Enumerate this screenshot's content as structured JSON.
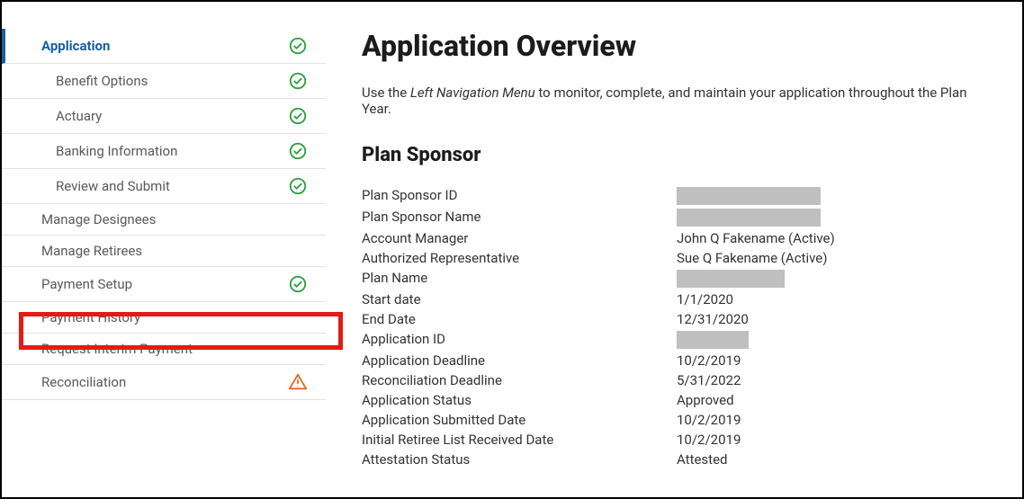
{
  "sidebar": {
    "items": [
      {
        "label": "Application",
        "status": "check",
        "level": "top",
        "active": true
      },
      {
        "label": "Benefit Options",
        "status": "check",
        "level": "sub",
        "active": false
      },
      {
        "label": "Actuary",
        "status": "check",
        "level": "sub",
        "active": false
      },
      {
        "label": "Banking Information",
        "status": "check",
        "level": "sub",
        "active": false
      },
      {
        "label": "Review and Submit",
        "status": "check",
        "level": "sub",
        "active": false
      },
      {
        "label": "Manage Designees",
        "status": "none",
        "level": "top",
        "active": false
      },
      {
        "label": "Manage Retirees",
        "status": "none",
        "level": "top",
        "active": false
      },
      {
        "label": "Payment Setup",
        "status": "check",
        "level": "top",
        "active": false
      },
      {
        "label": "Payment History",
        "status": "none",
        "level": "top",
        "active": false
      },
      {
        "label": "Request Interim Payment",
        "status": "none",
        "level": "top",
        "active": false
      },
      {
        "label": "Reconciliation",
        "status": "warn",
        "level": "top",
        "active": false
      }
    ]
  },
  "main": {
    "title": "Application Overview",
    "intro_prefix": "Use the ",
    "intro_em": "Left Navigation Menu",
    "intro_suffix": " to monitor, complete, and maintain your application throughout the Plan Year.",
    "section_title": "Plan Sponsor",
    "rows": [
      {
        "k": "Plan Sponsor ID",
        "v": "",
        "redacted": "w160"
      },
      {
        "k": "Plan Sponsor Name",
        "v": "",
        "redacted": "w160"
      },
      {
        "k": "Account Manager",
        "v": "John Q Fakename (Active)"
      },
      {
        "k": "Authorized Representative",
        "v": "Sue Q Fakename (Active)"
      },
      {
        "k": "Plan Name",
        "v": "",
        "redacted": "w120"
      },
      {
        "k": "Start date",
        "v": "1/1/2020"
      },
      {
        "k": "End Date",
        "v": "12/31/2020"
      },
      {
        "k": "Application ID",
        "v": "",
        "redacted": "w80"
      },
      {
        "k": "Application Deadline",
        "v": "10/2/2019"
      },
      {
        "k": "Reconciliation Deadline",
        "v": "5/31/2022"
      },
      {
        "k": "Application Status",
        "v": "Approved"
      },
      {
        "k": "Application Submitted Date",
        "v": "10/2/2019"
      },
      {
        "k": "Initial Retiree List Received Date",
        "v": "10/2/2019"
      },
      {
        "k": "Attestation Status",
        "v": "Attested"
      }
    ]
  }
}
